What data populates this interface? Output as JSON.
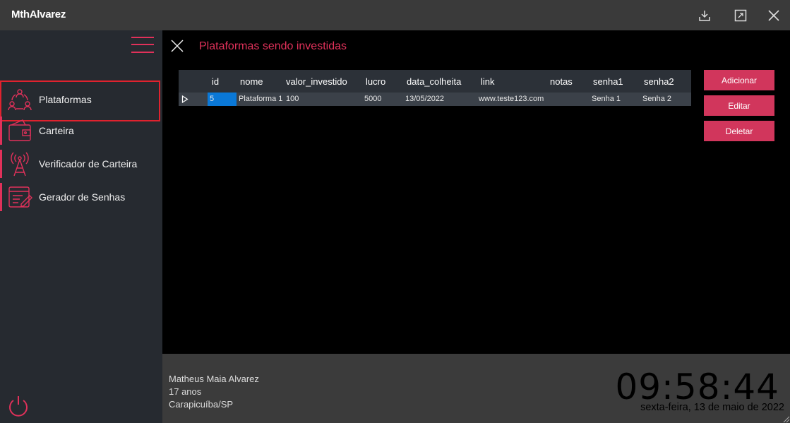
{
  "app": {
    "title": "MthAlvarez"
  },
  "window_controls": {
    "download_icon": "download-icon",
    "maximize_icon": "maximize-icon",
    "close_icon": "close-icon"
  },
  "sidebar": {
    "menu_icon": "hamburger-menu-icon",
    "items": [
      {
        "label": "Plataformas",
        "icon": "people-network-icon",
        "active": true
      },
      {
        "label": "Carteira",
        "icon": "wallet-icon",
        "active": false
      },
      {
        "label": "Verificador de Carteira",
        "icon": "antenna-tower-icon",
        "active": false
      },
      {
        "label": "Gerador de Senhas",
        "icon": "form-pencil-icon",
        "active": false
      }
    ],
    "power_icon": "power-icon"
  },
  "main": {
    "title": "Plataformas sendo investidas",
    "table": {
      "columns": [
        "id",
        "nome",
        "valor_investido",
        "lucro",
        "data_colheita",
        "link",
        "notas",
        "senha1",
        "senha2"
      ],
      "rows": [
        [
          "5",
          "Plataforma 1",
          "100",
          "5000",
          "13/05/2022",
          "www.teste123.com",
          "",
          "Senha 1",
          "Senha 2"
        ]
      ]
    },
    "buttons": {
      "add": "Adicionar",
      "edit": "Editar",
      "delete": "Deletar"
    }
  },
  "footer": {
    "user_name": "Matheus Maia Alvarez",
    "age": "17 anos",
    "location": "Carapicuíba/SP",
    "time": "09:58:44",
    "date": "sexta-feira, 13 de maio de 2022"
  },
  "colors": {
    "accent": "#e0315a",
    "button": "#d1365c",
    "selection": "#0a78d7",
    "sidebar": "#262a30"
  }
}
